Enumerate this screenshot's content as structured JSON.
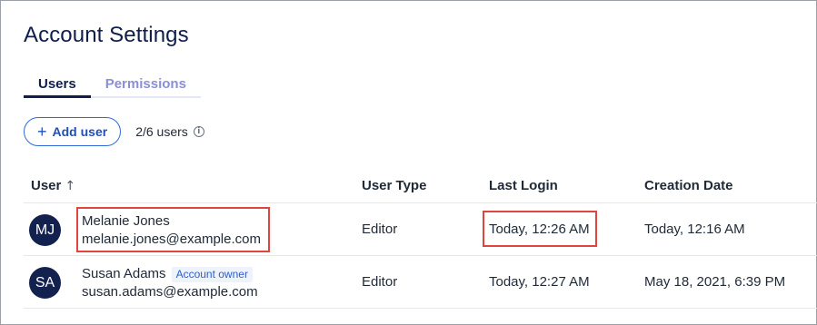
{
  "header": {
    "title": "Account Settings"
  },
  "tabs": [
    {
      "label": "Users",
      "active": true
    },
    {
      "label": "Permissions",
      "active": false
    }
  ],
  "toolbar": {
    "add_user_label": "Add user",
    "add_icon": "plus-icon",
    "user_count": "2/6 users",
    "info_icon": "info-icon"
  },
  "table": {
    "columns": [
      "User",
      "User Type",
      "Last Login",
      "Creation Date"
    ],
    "sort_icon": "arrow-up-icon",
    "rows": [
      {
        "initials": "MJ",
        "name": "Melanie Jones",
        "badge": "",
        "email": "melanie.jones@example.com",
        "user_type": "Editor",
        "last_login": "Today, 12:26 AM",
        "creation_date": "Today, 12:16 AM"
      },
      {
        "initials": "SA",
        "name": "Susan Adams",
        "badge": "Account owner",
        "email": "susan.adams@example.com",
        "user_type": "Editor",
        "last_login": "Today, 12:27 AM",
        "creation_date": "May 18, 2021, 6:39 PM"
      }
    ]
  },
  "colors": {
    "navy": "#13214f",
    "accent_blue": "#2f6bd8",
    "tab_inactive": "#8a8fd6",
    "highlight": "#e0443e"
  }
}
